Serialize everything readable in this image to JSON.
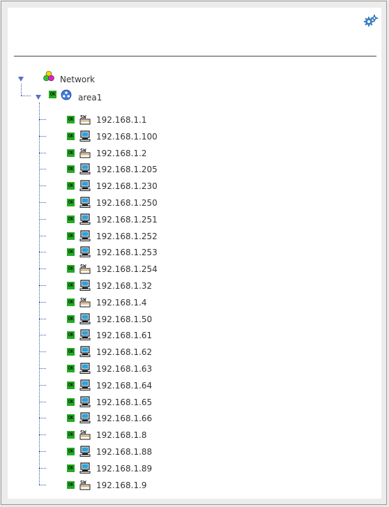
{
  "toolbar": {
    "settings_icon": "gears-icon"
  },
  "tree": {
    "root": {
      "label": "Network",
      "expanded": true,
      "icon": "network-circles-icon"
    },
    "group": {
      "label": "area1",
      "status": "OK",
      "expanded": true,
      "icon": "globe-icon"
    },
    "devices": [
      {
        "label": "192.168.1.1",
        "status": "OK",
        "type": "switch"
      },
      {
        "label": "192.168.1.100",
        "status": "OK",
        "type": "computer"
      },
      {
        "label": "192.168.1.2",
        "status": "OK",
        "type": "switch"
      },
      {
        "label": "192.168.1.205",
        "status": "OK",
        "type": "computer"
      },
      {
        "label": "192.168.1.230",
        "status": "OK",
        "type": "computer"
      },
      {
        "label": "192.168.1.250",
        "status": "OK",
        "type": "computer"
      },
      {
        "label": "192.168.1.251",
        "status": "OK",
        "type": "computer"
      },
      {
        "label": "192.168.1.252",
        "status": "OK",
        "type": "computer"
      },
      {
        "label": "192.168.1.253",
        "status": "OK",
        "type": "computer"
      },
      {
        "label": "192.168.1.254",
        "status": "OK",
        "type": "switch"
      },
      {
        "label": "192.168.1.32",
        "status": "OK",
        "type": "computer"
      },
      {
        "label": "192.168.1.4",
        "status": "OK",
        "type": "switch"
      },
      {
        "label": "192.168.1.50",
        "status": "OK",
        "type": "computer"
      },
      {
        "label": "192.168.1.61",
        "status": "OK",
        "type": "computer"
      },
      {
        "label": "192.168.1.62",
        "status": "OK",
        "type": "computer"
      },
      {
        "label": "192.168.1.63",
        "status": "OK",
        "type": "computer"
      },
      {
        "label": "192.168.1.64",
        "status": "OK",
        "type": "computer"
      },
      {
        "label": "192.168.1.65",
        "status": "OK",
        "type": "computer"
      },
      {
        "label": "192.168.1.66",
        "status": "OK",
        "type": "computer"
      },
      {
        "label": "192.168.1.8",
        "status": "OK",
        "type": "switch"
      },
      {
        "label": "192.168.1.88",
        "status": "OK",
        "type": "computer"
      },
      {
        "label": "192.168.1.89",
        "status": "OK",
        "type": "computer"
      },
      {
        "label": "192.168.1.9",
        "status": "OK",
        "type": "switch"
      }
    ]
  },
  "colors": {
    "ok_badge": "#22aa22",
    "tree_line": "#3355aa",
    "toggle": "#5570c8",
    "gear": "#3a7fc0"
  }
}
